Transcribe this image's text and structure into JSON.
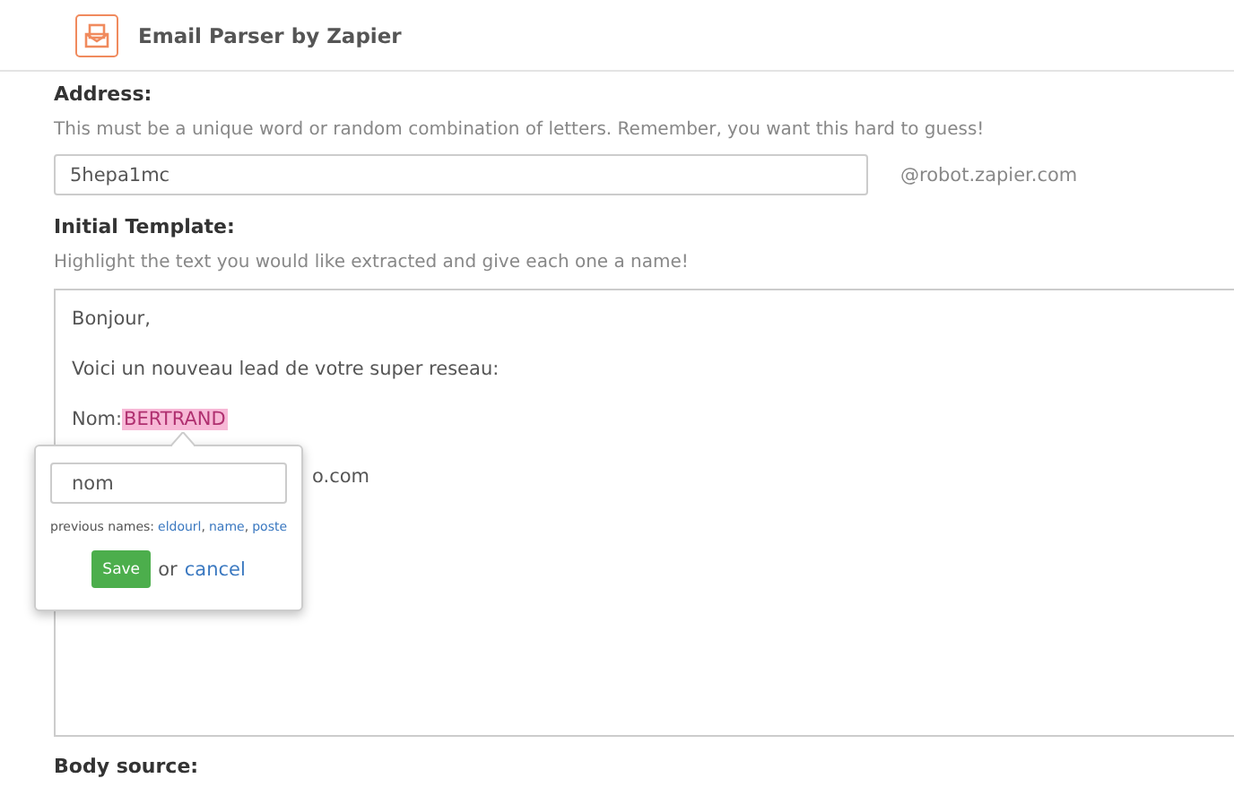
{
  "header": {
    "title": "Email Parser by Zapier"
  },
  "address": {
    "label": "Address:",
    "hint": "This must be a unique word or random combination of letters. Remember, you want this hard to guess!",
    "value": "5hepa1mc",
    "suffix": "@robot.zapier.com"
  },
  "template": {
    "label": "Initial Template:",
    "hint": "Highlight the text you would like extracted and give each one a name!",
    "lines": [
      {
        "kind": "text",
        "text": "Bonjour,"
      },
      {
        "kind": "text",
        "text": "Voici un nouveau lead de votre super reseau:"
      },
      {
        "kind": "field",
        "text": "Nom:",
        "highlight": "BERTRAND"
      },
      {
        "kind": "fragment",
        "text": "o.com"
      }
    ]
  },
  "popup": {
    "value": "nom",
    "previous_label": "previous names:",
    "previous": [
      "eldourl",
      "name",
      "poste"
    ],
    "separator": ",",
    "save": "Save",
    "or": "or",
    "cancel": "cancel"
  },
  "body_source": {
    "label": "Body source:"
  }
}
